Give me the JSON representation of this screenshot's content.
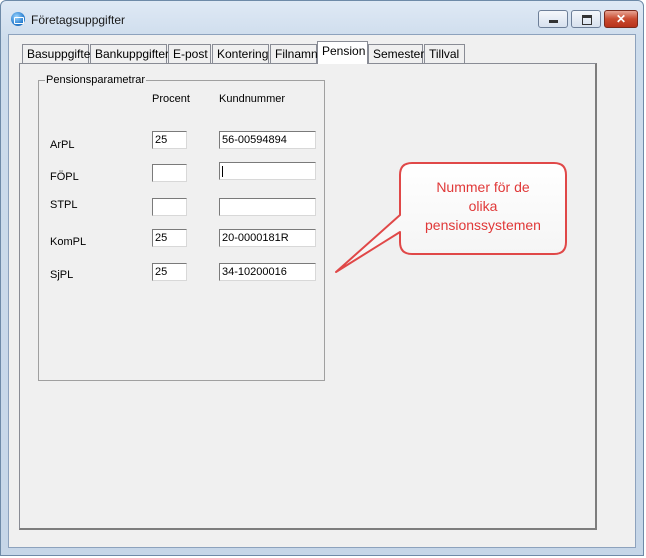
{
  "window": {
    "title": "Företagsuppgifter"
  },
  "titlebar_buttons": {
    "close_glyph": "✕"
  },
  "tabs": [
    {
      "label": "Basuppgifter",
      "active": false
    },
    {
      "label": "Bankuppgifter",
      "active": false
    },
    {
      "label": "E-post",
      "active": false
    },
    {
      "label": "Kontering",
      "active": false
    },
    {
      "label": "Filnamn",
      "active": false
    },
    {
      "label": "Pension",
      "active": true
    },
    {
      "label": "Semester",
      "active": false
    },
    {
      "label": "Tillval",
      "active": false
    }
  ],
  "pension": {
    "group_title": "Pensionsparametrar",
    "columns": {
      "procent": "Procent",
      "kundnummer": "Kundnummer"
    },
    "rows": [
      {
        "label": "ArPL",
        "procent": "25",
        "kundnummer": "56-00594894"
      },
      {
        "label": "FÖPL",
        "procent": "",
        "kundnummer": ""
      },
      {
        "label": "STPL",
        "procent": "",
        "kundnummer": ""
      },
      {
        "label": "KomPL",
        "procent": "25",
        "kundnummer": "20-0000181R"
      },
      {
        "label": "SjPL",
        "procent": "25",
        "kundnummer": "34-10200016"
      }
    ]
  },
  "callout": {
    "line1": "Nummer för de",
    "line2": "olika",
    "line3": "pensionssystemen",
    "color": "#e03838"
  }
}
